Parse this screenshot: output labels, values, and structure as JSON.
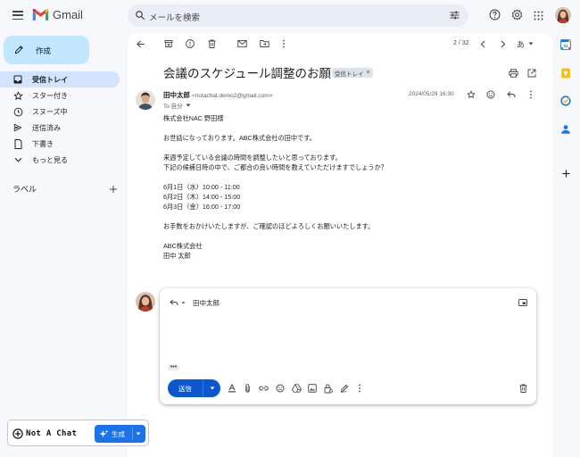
{
  "app": {
    "name": "Gmail"
  },
  "search": {
    "placeholder": "メールを検索"
  },
  "sidebar": {
    "compose_label": "作成",
    "items": [
      {
        "label": "受信トレイ",
        "icon": "inbox-icon",
        "active": true
      },
      {
        "label": "スター付き",
        "icon": "star-icon",
        "active": false
      },
      {
        "label": "スヌーズ中",
        "icon": "clock-icon",
        "active": false
      },
      {
        "label": "送信済み",
        "icon": "send-icon",
        "active": false
      },
      {
        "label": "下書き",
        "icon": "draft-icon",
        "active": false
      },
      {
        "label": "もっと見る",
        "icon": "chevron-down-icon",
        "active": false
      }
    ],
    "labels_heading": "ラベル"
  },
  "toolbar": {
    "pager": "2 / 32",
    "input_tool": "あ"
  },
  "email": {
    "subject": "会議のスケジュール調整のお願い",
    "chip": "受信トレイ",
    "chip_close": "×",
    "sender_name": "田中太郎",
    "sender_email": "<notachat.demo2@gmail.com>",
    "to": "To 自分",
    "date": "2024/05/29 16:30",
    "body": [
      [
        "株式会社NAC 野田様"
      ],
      [
        "お世話になっております。ABC株式会社の田中です。"
      ],
      [
        "来週予定している会議の時間を調整したいと思っております。",
        "下記の候補日時の中で、ご都合の良い時間を教えていただけますでしょうか？"
      ],
      [
        "6月1日（水）10:00 - 11:00",
        "6月2日（木）14:00 - 15:00",
        "6月3日（金）16:00 - 17:00"
      ],
      [
        "お手数をおかけいたしますが、ご確認のほどよろしくお願いいたします。"
      ],
      [
        "ABC株式会社",
        "田中 太郎"
      ]
    ]
  },
  "reply": {
    "recipient": "田中太郎",
    "ellipsis": "•••",
    "send_label": "送信"
  },
  "extension": {
    "brand": "Not A Chat",
    "generate_label": "生成"
  },
  "colors": {
    "accent": "#0b57d0",
    "compose_bg": "#c2e7ff",
    "active_nav": "#d3e3fd",
    "page_bg": "#f6f8fc"
  }
}
